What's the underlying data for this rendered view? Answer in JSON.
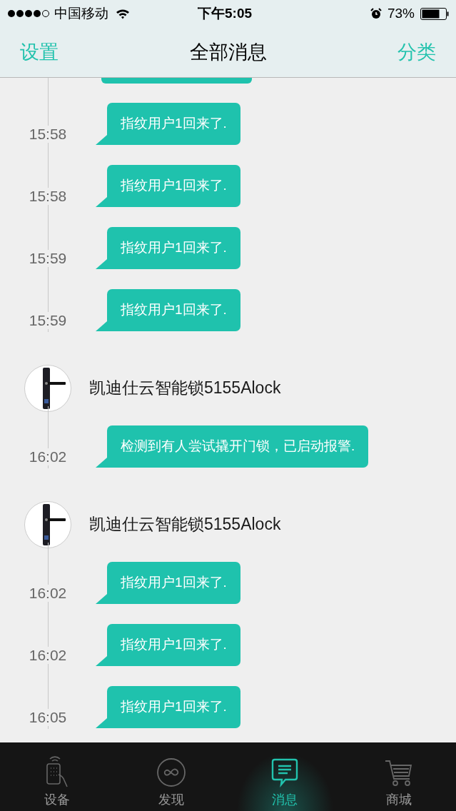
{
  "status_bar": {
    "carrier": "中国移动",
    "time": "下午5:05",
    "battery": "73%"
  },
  "nav_bar": {
    "left": "设置",
    "title": "全部消息",
    "right": "分类"
  },
  "messages": [
    {
      "kind": "message",
      "text": "指纹用户1回来了.",
      "time": "15:58"
    },
    {
      "kind": "message",
      "text": "指纹用户1回来了.",
      "time": "15:58"
    },
    {
      "kind": "message",
      "text": "指纹用户1回来了.",
      "time": "15:59"
    },
    {
      "kind": "message",
      "text": "指纹用户1回来了.",
      "time": "15:59"
    },
    {
      "kind": "device",
      "name": "凯迪仕云智能锁5155Alock"
    },
    {
      "kind": "message",
      "text": "检测到有人尝试撬开门锁，已启动报警.",
      "time": "16:02"
    },
    {
      "kind": "device",
      "name": "凯迪仕云智能锁5155Alock"
    },
    {
      "kind": "message",
      "text": "指纹用户1回来了.",
      "time": "16:02"
    },
    {
      "kind": "message",
      "text": "指纹用户1回来了.",
      "time": "16:02"
    },
    {
      "kind": "message",
      "text": "指纹用户1回来了.",
      "time": "16:05"
    }
  ],
  "tab_bar": [
    {
      "kind": "device",
      "label": "设备",
      "selected": false
    },
    {
      "kind": "discover",
      "label": "发现",
      "selected": false
    },
    {
      "kind": "message",
      "label": "消息",
      "selected": true
    },
    {
      "kind": "shop",
      "label": "商城",
      "selected": false
    }
  ]
}
